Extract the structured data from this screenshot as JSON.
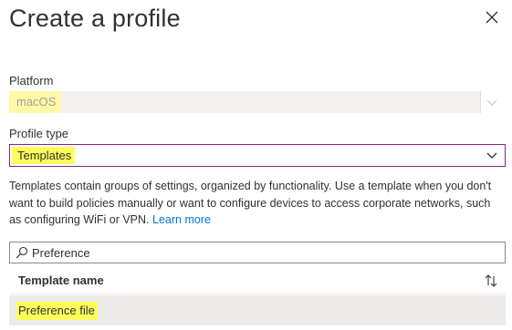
{
  "panel": {
    "title": "Create a profile"
  },
  "platform": {
    "label": "Platform",
    "value": "macOS",
    "disabled": true
  },
  "profile_type": {
    "label": "Profile type",
    "value": "Templates"
  },
  "description": {
    "text": "Templates contain groups of settings, organized by functionality. Use a template when you don't want to build policies manually or want to configure devices to access corporate networks, such as configuring WiFi or VPN. ",
    "link": "Learn more"
  },
  "search": {
    "value": "Preference"
  },
  "table": {
    "column_header": "Template name",
    "rows": [
      {
        "name": "Preference file"
      }
    ]
  },
  "icons": {
    "close": "close-icon",
    "chevron": "chevron-down-icon",
    "search": "search-icon",
    "sort": "sort-icon"
  },
  "colors": {
    "highlight": "#ffff5c",
    "focus_border": "#8a1f8a",
    "link": "#0078d4"
  }
}
